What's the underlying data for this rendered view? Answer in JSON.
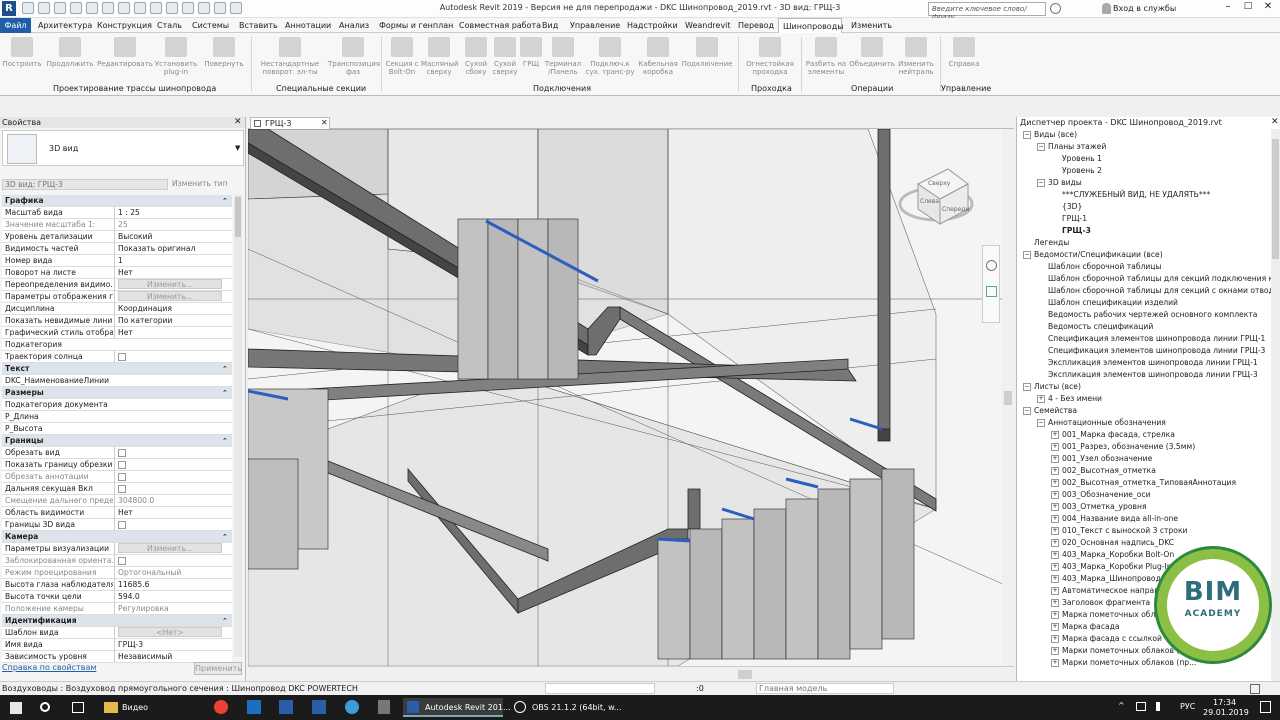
{
  "window": {
    "title": "Autodesk Revit 2019 - Версия не для перепродажи - DKC Шинопровод_2019.rvt - 3D вид: ГРЩ-3",
    "search_placeholder": "Введите ключевое слово/фразу",
    "login": "Вход в службы"
  },
  "menu": [
    "Файл",
    "Архитектура",
    "Конструкция",
    "Сталь",
    "Системы",
    "Вставить",
    "Аннотации",
    "Анализ",
    "Формы и генплан",
    "Совместная работа",
    "Вид",
    "Управление",
    "Надстройки",
    "Weandrevit",
    "Перевод",
    "Шинопроводы",
    "Изменить"
  ],
  "ribbon": {
    "buttons": [
      "Построить",
      "Продолжить",
      "Редактировать",
      "Установить plug-in",
      "Повернуть",
      "Нестандартные поворот. эл-ты",
      "Транспозиция фаз",
      "Секция с Bolt-On",
      "Масляный сверху",
      "Сухой сбоку",
      "Сухой сверху",
      "ГРЩ",
      "Терминал /Панель",
      "Подключ.к сух. транс-ру",
      "Кабельная коробка",
      "Подключение",
      "Огнестойкая проходка",
      "Разбить на элементы",
      "Объединить",
      "Изменить нейтраль",
      "Справка"
    ],
    "panels": [
      "Проектирование трассы шинопровода",
      "Специальные секции",
      "Подключения",
      "Проходка",
      "Операции",
      "Управление"
    ]
  },
  "properties": {
    "title": "Свойства",
    "type": "3D вид",
    "instance": "3D вид: ГРЩ-3",
    "edit_type": "Изменить тип",
    "rows": [
      {
        "g": "Графика"
      },
      {
        "k": "Масштаб вида",
        "v": "1 : 25"
      },
      {
        "k": "Значение масштаба    1:",
        "v": "25",
        "d": 1
      },
      {
        "k": "Уровень детализации",
        "v": "Высокий"
      },
      {
        "k": "Видимость частей",
        "v": "Показать оригинал"
      },
      {
        "k": "Номер вида",
        "v": "1"
      },
      {
        "k": "Поворот на листе",
        "v": "Нет"
      },
      {
        "k": "Переопределения видимо...",
        "b": "Изменить..."
      },
      {
        "k": "Параметры отображения г...",
        "b": "Изменить..."
      },
      {
        "k": "Дисциплина",
        "v": "Координация"
      },
      {
        "k": "Показать невидимые линии",
        "v": "По категории"
      },
      {
        "k": "Графический стиль отобра...",
        "v": "Нет"
      },
      {
        "k": "Подкатегория",
        "v": ""
      },
      {
        "k": "Траектория солнца",
        "c": 1
      },
      {
        "g": "Текст"
      },
      {
        "k": "DKC_НаименованиеЛинии",
        "v": ""
      },
      {
        "g": "Размеры"
      },
      {
        "k": "Подкатегория документа",
        "v": ""
      },
      {
        "k": "Р_Длина",
        "v": ""
      },
      {
        "k": "Р_Высота",
        "v": ""
      },
      {
        "g": "Границы"
      },
      {
        "k": "Обрезать вид",
        "c": 1
      },
      {
        "k": "Показать границу обрезки",
        "c": 1
      },
      {
        "k": "Обрезать аннотации",
        "c": 1,
        "d": 1
      },
      {
        "k": "Дальняя секущая Вкл",
        "c": 1
      },
      {
        "k": "Смещение дальнего преде...",
        "v": "304800.0",
        "d": 1
      },
      {
        "k": "Область видимости",
        "v": "Нет"
      },
      {
        "k": "Границы 3D вида",
        "c": 1
      },
      {
        "g": "Камера"
      },
      {
        "k": "Параметры визуализации",
        "b": "Изменить..."
      },
      {
        "k": "Заблокированная ориента...",
        "c": 1,
        "d": 1
      },
      {
        "k": "Режим проецирования",
        "v": "Ортогональный",
        "d": 1
      },
      {
        "k": "Высота глаза наблюдателя",
        "v": "11685.6"
      },
      {
        "k": "Высота точки цели",
        "v": "594.0"
      },
      {
        "k": "Положение камеры",
        "v": "Регулировка",
        "d": 1
      },
      {
        "g": "Идентификация"
      },
      {
        "k": "Шаблон вида",
        "b": "<Нет>"
      },
      {
        "k": "Имя вида",
        "v": "ГРЩ-3"
      },
      {
        "k": "Зависимость уровня",
        "v": "Независимый"
      }
    ],
    "help_link": "Справка по свойствам",
    "apply": "Применить"
  },
  "view_tab": "ГРЩ-3",
  "viewcube": {
    "top": "Сверху",
    "front": "Спереди",
    "left": "Слева"
  },
  "browser": {
    "title": "Диспетчер проекта - DKC Шинопровод_2019.rvt",
    "items": [
      {
        "t": "Виды (все)",
        "l": 0,
        "x": "−"
      },
      {
        "t": "Планы этажей",
        "l": 1,
        "x": "−"
      },
      {
        "t": "Уровень 1",
        "l": 2
      },
      {
        "t": "Уровень 2",
        "l": 2
      },
      {
        "t": "3D виды",
        "l": 1,
        "x": "−"
      },
      {
        "t": "***СЛУЖЕБНЫЙ ВИД, НЕ УДАЛЯТЬ***",
        "l": 2
      },
      {
        "t": "{3D}",
        "l": 2
      },
      {
        "t": "ГРЩ-1",
        "l": 2
      },
      {
        "t": "ГРЩ-3",
        "l": 2,
        "b": 1
      },
      {
        "t": "Легенды",
        "l": 0
      },
      {
        "t": "Ведомости/Спецификации (все)",
        "l": 0,
        "x": "−"
      },
      {
        "t": "Шаблон сборочной таблицы",
        "l": 1
      },
      {
        "t": "Шаблон сборочной таблицы для секций подключения к сухом",
        "l": 1
      },
      {
        "t": "Шаблон сборочной таблицы для секций с окнами отвода",
        "l": 1
      },
      {
        "t": "Шаблон спецификации изделий",
        "l": 1
      },
      {
        "t": "Ведомость рабочих чертежей основного комплекта",
        "l": 1
      },
      {
        "t": "Ведомость спецификаций",
        "l": 1
      },
      {
        "t": "Спецификация элементов шинопровода линии ГРЩ-1",
        "l": 1
      },
      {
        "t": "Спецификация элементов шинопровода линии ГРЩ-3",
        "l": 1
      },
      {
        "t": "Экспликация элементов шинопровода линии ГРЩ-1",
        "l": 1
      },
      {
        "t": "Экспликация элементов шинопровода линии ГРЩ-3",
        "l": 1
      },
      {
        "t": "Листы (все)",
        "l": 0,
        "x": "−"
      },
      {
        "t": "4 - Без имени",
        "l": 1,
        "x": "+"
      },
      {
        "t": "Семейства",
        "l": 0,
        "x": "−"
      },
      {
        "t": "Аннотационные обозначения",
        "l": 1,
        "x": "−"
      },
      {
        "t": "001_Марка фасада, стрелка",
        "l": 2,
        "x": "+"
      },
      {
        "t": "001_Разрез, обозначение (3.5мм)",
        "l": 2,
        "x": "+"
      },
      {
        "t": "001_Узел обозначение",
        "l": 2,
        "x": "+"
      },
      {
        "t": "002_Высотная_отметка",
        "l": 2,
        "x": "+"
      },
      {
        "t": "002_Высотная_отметка_ТиповаяАннотация",
        "l": 2,
        "x": "+"
      },
      {
        "t": "003_Обозначение_оси",
        "l": 2,
        "x": "+"
      },
      {
        "t": "003_Отметка_уровня",
        "l": 2,
        "x": "+"
      },
      {
        "t": "004_Название вида all-in-one",
        "l": 2,
        "x": "+"
      },
      {
        "t": "010_Текст с выноской 3 строки",
        "l": 2,
        "x": "+"
      },
      {
        "t": "020_Основная надпись_DKC",
        "l": 2,
        "x": "+"
      },
      {
        "t": "403_Марка_Коробки Bolt-On",
        "l": 2,
        "x": "+"
      },
      {
        "t": "403_Марка_Коробки Plug-In",
        "l": 2,
        "x": "+"
      },
      {
        "t": "403_Марка_Шинопровод",
        "l": 2,
        "x": "+"
      },
      {
        "t": "Автоматическое направление",
        "l": 2,
        "x": "+"
      },
      {
        "t": "Заголовок фрагмента",
        "l": 2,
        "x": "+"
      },
      {
        "t": "Марка пометочных облаков",
        "l": 2,
        "x": "+"
      },
      {
        "t": "Марка фасада",
        "l": 2,
        "x": "+"
      },
      {
        "t": "Марка фасада с ссылкой",
        "l": 2,
        "x": "+"
      },
      {
        "t": "Марки пометочных облаков (ка...",
        "l": 2,
        "x": "+"
      },
      {
        "t": "Марки пометочных облаков (пр...",
        "l": 2,
        "x": "+"
      }
    ]
  },
  "logo": {
    "line1": "BIM",
    "line2": "ACADEMY"
  },
  "status": {
    "text": "Воздуховоды : Воздуховод прямоугольного сечения : Шинопровод DKC POWERTECH",
    "zero": ":0",
    "model": "Главная модель"
  },
  "taskbar": {
    "items": [
      "Видео",
      "Autodesk Revit 201...",
      "OBS 21.1.2 (64bit, w..."
    ],
    "lang": "РУС",
    "time": "17:34",
    "date": "29.01.2019"
  }
}
